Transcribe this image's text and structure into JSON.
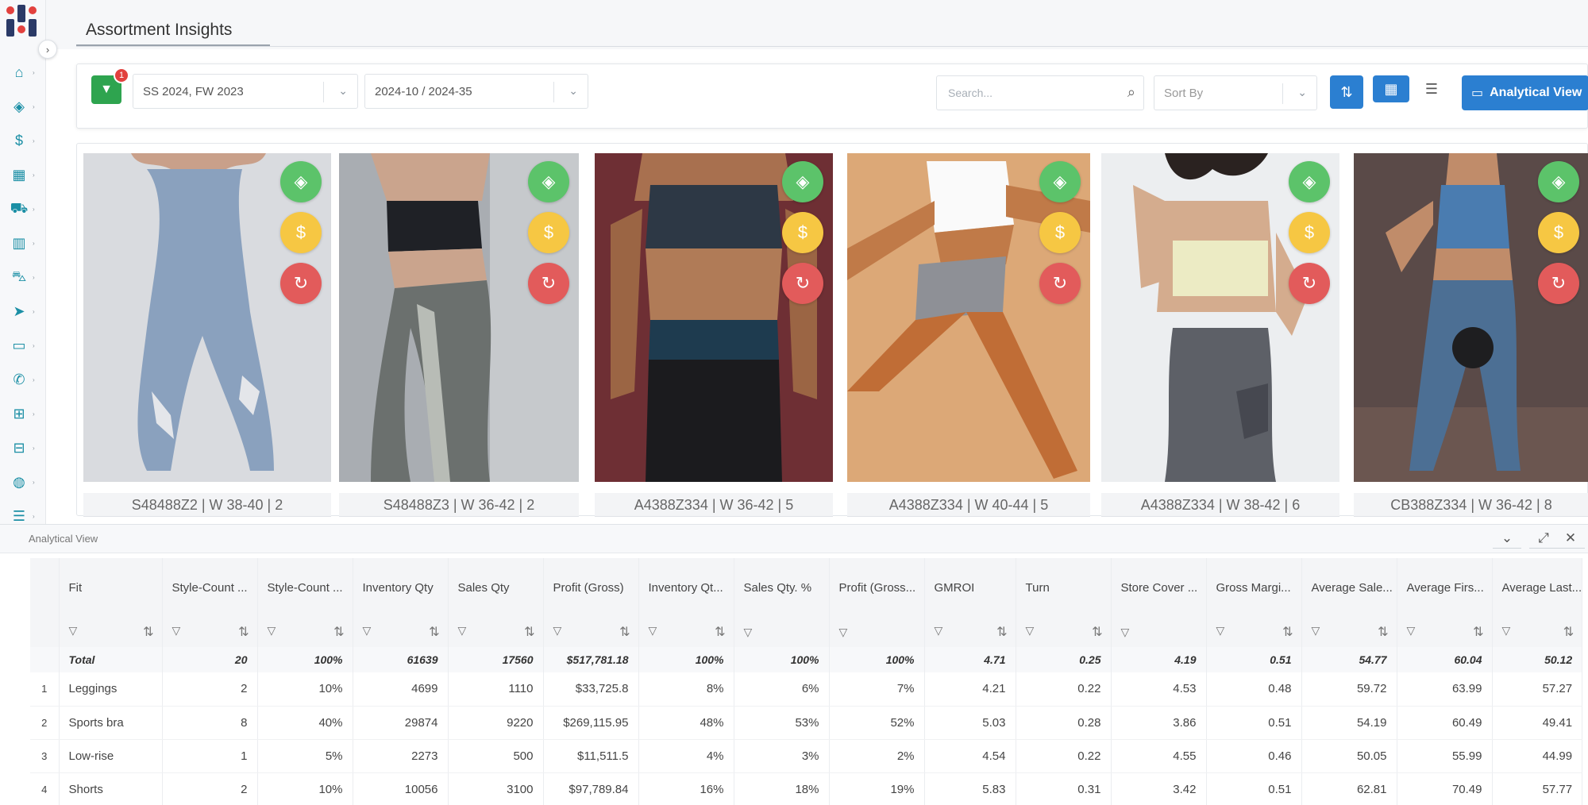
{
  "app": {
    "logo": "brand-logo"
  },
  "header": {
    "title": "Assortment Insights"
  },
  "sidebar": {
    "items": [
      {
        "icon": "home-icon",
        "glyph": "⌂"
      },
      {
        "icon": "tag-icon",
        "glyph": "◈"
      },
      {
        "icon": "dollar-icon",
        "glyph": "$"
      },
      {
        "icon": "analytics-icon",
        "glyph": "▦"
      },
      {
        "icon": "cart-icon",
        "glyph": "⛟"
      },
      {
        "icon": "warehouse-icon",
        "glyph": "▥"
      },
      {
        "icon": "truck-icon",
        "glyph": "⛍"
      },
      {
        "icon": "send-icon",
        "glyph": "➤"
      },
      {
        "icon": "monitor-icon",
        "glyph": "▭"
      },
      {
        "icon": "megaphone-icon",
        "glyph": "✆"
      },
      {
        "icon": "hierarchy-icon",
        "glyph": "⊞"
      },
      {
        "icon": "users-icon",
        "glyph": "⊟"
      },
      {
        "icon": "globe-icon",
        "glyph": "◍"
      },
      {
        "icon": "list-icon",
        "glyph": "☰"
      }
    ]
  },
  "filters": {
    "badge_count": "1",
    "season": "SS 2024, FW 2023",
    "week_range": "2024-10 / 2024-35",
    "search_placeholder": "Search...",
    "sort_placeholder": "Sort By",
    "analytical_view_label": "Analytical View"
  },
  "products": [
    {
      "caption": "S48488Z2 | W 38-40 | 2"
    },
    {
      "caption": "S48488Z3 | W 36-42 | 2"
    },
    {
      "caption": "A4388Z334 | W 36-42 | 5"
    },
    {
      "caption": "A4388Z334 | W 40-44 | 5"
    },
    {
      "caption": "A4388Z334 | W 38-42 | 6"
    },
    {
      "caption": "CB388Z334 | W 36-42 | 8"
    }
  ],
  "panel": {
    "title": "Analytical View",
    "columns": [
      "Fit",
      "Style-Count ...",
      "Style-Count ...",
      "Inventory Qty",
      "Sales Qty",
      "Profit (Gross)",
      "Inventory Qt...",
      "Sales Qty. %",
      "Profit (Gross...",
      "GMROI",
      "Turn",
      "Store Cover ...",
      "Gross Margi...",
      "Average Sale...",
      "Average Firs...",
      "Average Last..."
    ],
    "total": [
      "Total",
      "20",
      "100%",
      "61639",
      "17560",
      "$517,781.18",
      "100%",
      "100%",
      "100%",
      "4.71",
      "0.25",
      "4.19",
      "0.51",
      "54.77",
      "60.04",
      "50.12"
    ],
    "rows": [
      {
        "idx": "1",
        "cells": [
          "Leggings",
          "2",
          "10%",
          "4699",
          "1110",
          "$33,725.8",
          "8%",
          "6%",
          "7%",
          "4.21",
          "0.22",
          "4.53",
          "0.48",
          "59.72",
          "63.99",
          "57.27"
        ]
      },
      {
        "idx": "2",
        "cells": [
          "Sports bra",
          "8",
          "40%",
          "29874",
          "9220",
          "$269,115.95",
          "48%",
          "53%",
          "52%",
          "5.03",
          "0.28",
          "3.86",
          "0.51",
          "54.19",
          "60.49",
          "49.41"
        ]
      },
      {
        "idx": "3",
        "cells": [
          "Low-rise",
          "1",
          "5%",
          "2273",
          "500",
          "$11,511.5",
          "4%",
          "3%",
          "2%",
          "4.54",
          "0.22",
          "4.55",
          "0.46",
          "50.05",
          "55.99",
          "44.99"
        ]
      },
      {
        "idx": "4",
        "cells": [
          "Shorts",
          "2",
          "10%",
          "10056",
          "3100",
          "$97,789.84",
          "16%",
          "18%",
          "19%",
          "5.83",
          "0.31",
          "3.42",
          "0.51",
          "62.81",
          "70.49",
          "57.77"
        ]
      }
    ]
  },
  "colors": {
    "accent": "#2b7fd1",
    "green": "#2ea44f",
    "sidebar_icon": "#1b8fa5"
  }
}
